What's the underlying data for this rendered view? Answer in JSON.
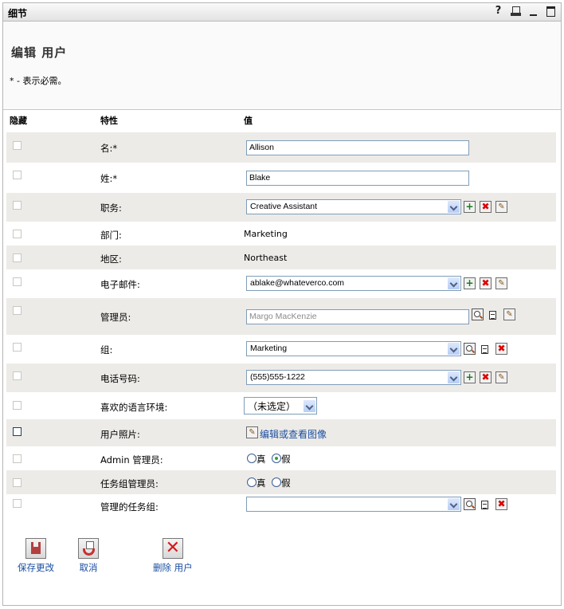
{
  "window": {
    "title": "细节",
    "icons": [
      "help-icon",
      "print-icon",
      "minimize-icon",
      "maximize-icon"
    ],
    "help_glyph": "?"
  },
  "header": {
    "title": "编辑  用户",
    "required_note": "* - 表示必需。"
  },
  "columns": {
    "hide": "隐藏",
    "attribute": "特性",
    "value": "值"
  },
  "fields": {
    "first_name": {
      "label": "名:*",
      "value": "Allison"
    },
    "last_name": {
      "label": "姓:*",
      "value": "Blake"
    },
    "title": {
      "label": "职务:",
      "value": "Creative Assistant"
    },
    "department": {
      "label": "部门:",
      "value": "Marketing"
    },
    "region": {
      "label": "地区:",
      "value": "Northeast"
    },
    "email": {
      "label": "电子邮件:",
      "value": "ablake@whateverco.com"
    },
    "manager": {
      "label": "管理员:",
      "value": "Margo MacKenzie"
    },
    "group": {
      "label": "组:",
      "value": "Marketing"
    },
    "phone": {
      "label": "电话号码:",
      "value": "(555)555-1222"
    },
    "locale": {
      "label": "喜欢的语言环境:",
      "value": "（未选定）"
    },
    "photo": {
      "label": "用户照片:",
      "link": "编辑或查看图像"
    },
    "admin": {
      "label": "Admin 管理员:",
      "true_label": "真",
      "false_label": "假",
      "selected": "false"
    },
    "taskgroup_admin": {
      "label": "任务组管理员:",
      "true_label": "真",
      "false_label": "假",
      "selected": "none"
    },
    "managed_taskgroups": {
      "label": "管理的任务组:",
      "value": ""
    }
  },
  "actions": {
    "save": "保存更改",
    "cancel": "取消",
    "delete": "删除  用户"
  },
  "button_glyphs": {
    "add": "+",
    "delete": "✖",
    "edit": "✎"
  }
}
